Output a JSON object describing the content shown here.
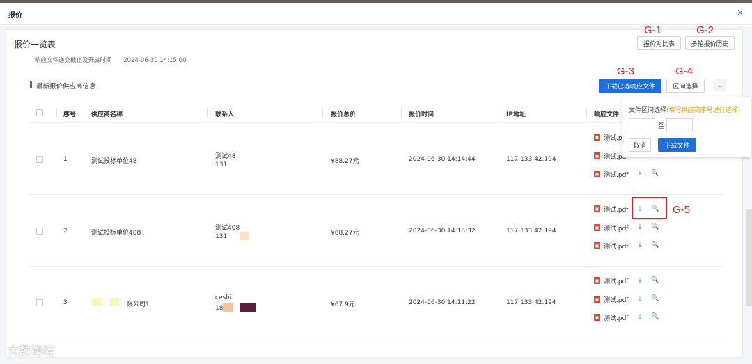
{
  "modal": {
    "title": "报价",
    "close_icon": "×"
  },
  "card": {
    "title": "报价一览表",
    "buttons": {
      "compare": "报价对比表",
      "history": "多轮报价历史",
      "download_selected": "下载已选响应文件",
      "range_select": "区间选择"
    },
    "annotations": {
      "g1": "G-1",
      "g2": "G-2",
      "g3": "G-3",
      "g4": "G-4",
      "g5": "G-5"
    },
    "meta": {
      "label": "响应文件递交截止及开启时间",
      "value": "2024-06-30 14:15:00"
    },
    "section_title": "最新报价供应商信息",
    "collapse_icon": "⌄"
  },
  "table": {
    "headers": [
      "序号",
      "供应商名称",
      "联系人",
      "报价总价",
      "报价时间",
      "IP地址",
      "响应文件"
    ],
    "rows": [
      {
        "index": "1",
        "supplier": "测试投标单位48",
        "contact_name": "测试48",
        "contact_phone": "131",
        "price": "¥88.27元",
        "time": "2024-06-30 14:14:44",
        "ip": "117.133.42.194",
        "files": [
          "测试.pdf",
          "测试.pdf",
          "测试.pdf"
        ]
      },
      {
        "index": "2",
        "supplier": "测试投标单位408",
        "contact_name": "测试408",
        "contact_phone": "131",
        "price": "¥88.27元",
        "time": "2024-06-30 14:13:32",
        "ip": "117.133.42.194",
        "files": [
          "测试.pdf",
          "测试.pdf",
          "测试.pdf"
        ]
      },
      {
        "index": "3",
        "supplier": "限公司1",
        "contact_name": "ceshi",
        "contact_phone": "188",
        "price": "¥67.9元",
        "time": "2024-06-30 14:11:22",
        "ip": "117.133.42.194",
        "files": [
          "测试.pdf",
          "测试.pdf",
          "测试.pdf"
        ]
      }
    ],
    "file_icon": "pdf-icon",
    "download_icon": "⤓",
    "preview_icon": "🔍"
  },
  "popup": {
    "label": "文件区间选择",
    "hint": "(填写供应商序号进行选择)",
    "to": "至",
    "cancel": "取消",
    "download": "下载文件"
  },
  "watermark": "大数跨境",
  "colors": {
    "primary": "#1f6fd6",
    "annotation": "#e02020",
    "pdf": "#e0442f",
    "hint": "#f39c12"
  }
}
